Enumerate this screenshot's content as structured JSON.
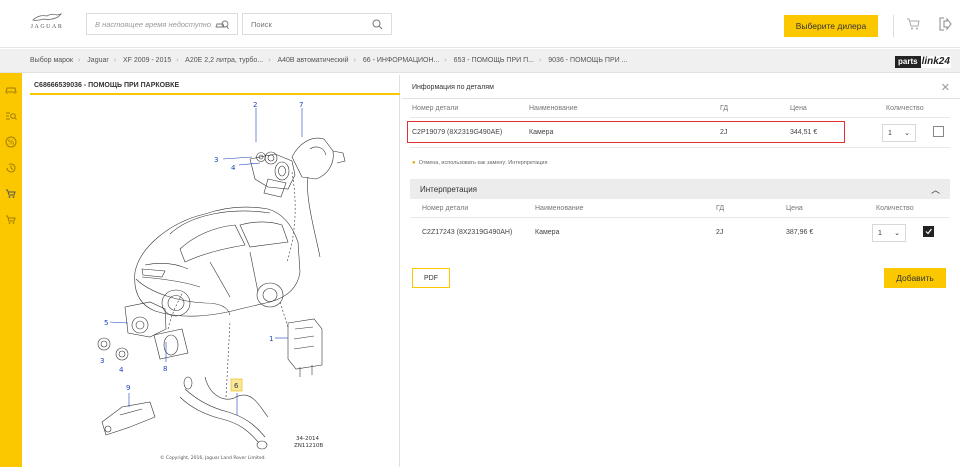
{
  "header": {
    "logo_text": "JAGUAR",
    "status_text": "В настоящее время недоступно",
    "search_placeholder": "Поиск",
    "dealer_button": "Выберите дилера"
  },
  "breadcrumbs": [
    "Выбор марок",
    "Jaguar",
    "XF 2009 - 2015",
    "A20E 2,2 литра, турбо...",
    "A40B автоматический",
    "66 - ИНФОРМАЦИОН...",
    "653 - ПОМОЩЬ ПРИ П...",
    "9036 - ПОМОЩЬ ПРИ ..."
  ],
  "partslink": {
    "part_a": "parts",
    "part_b": "link24"
  },
  "diagram": {
    "title": "C68666539036 - ПОМОЩЬ ПРИ ПАРКОВКЕ",
    "copyright": "© Copyright, 2016, Jaguar Land Rover Limited.",
    "ref_code_1": "34-2014",
    "ref_code_2": "ZN11210B",
    "callouts": {
      "c1": "1",
      "c2": "2",
      "c3a": "3",
      "c3b": "3",
      "c4a": "4",
      "c4b": "4",
      "c5": "5",
      "c6": "6",
      "c7": "7",
      "c8": "8",
      "c9": "9"
    }
  },
  "info": {
    "title": "Информация по деталям",
    "columns": {
      "part": "Номер детали",
      "name": "Наименование",
      "gd": "ГД",
      "price": "Цена",
      "qty": "Количество"
    },
    "row": {
      "part": "C2P19079 (8X2319G490AE)",
      "name": "Камера",
      "gd": "2J",
      "price": "344,51 €",
      "qty": "1"
    },
    "hint": "Отмена, использовать как замену: Интерпретация",
    "interpretation": {
      "title": "Интерпретация",
      "columns": {
        "part": "Номер детали",
        "name": "Наименование",
        "gd": "ГД",
        "price": "Цена",
        "qty": "Количество"
      },
      "row": {
        "part": "C2Z17243 (8X2319G490AH)",
        "name": "Камера",
        "gd": "2J",
        "price": "387,96 €",
        "qty": "1"
      }
    },
    "pdf_button": "PDF",
    "add_button": "Добавить"
  },
  "colors": {
    "accent": "#fbc800",
    "highlight": "#e03030",
    "callout": "#1a3fc0"
  }
}
